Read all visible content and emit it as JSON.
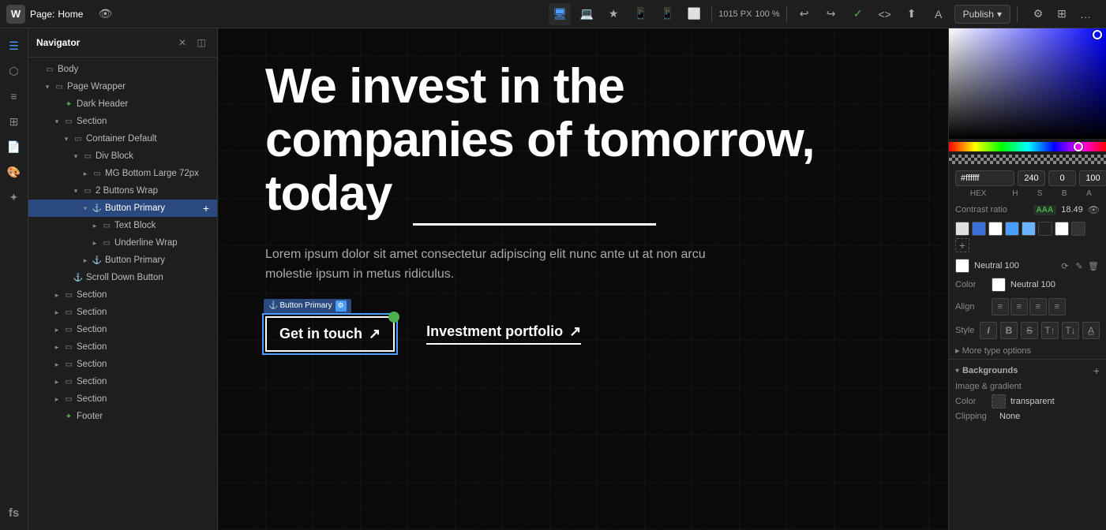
{
  "topbar": {
    "logo": "W",
    "page_label": "Page:",
    "page_name": "Home",
    "dimensions": "1015 PX",
    "zoom": "100 %",
    "publish_label": "Publish",
    "undo_label": "↩",
    "redo_label": "↪"
  },
  "navigator": {
    "title": "Navigator",
    "tree": [
      {
        "indent": 0,
        "type": "box",
        "label": "Body",
        "arrow": "",
        "icon_type": "box",
        "depth": 0
      },
      {
        "indent": 1,
        "type": "box",
        "label": "Page Wrapper",
        "arrow": "▾",
        "icon_type": "box",
        "depth": 1
      },
      {
        "indent": 2,
        "type": "green",
        "label": "Dark Header",
        "arrow": "",
        "icon_type": "green",
        "depth": 2
      },
      {
        "indent": 2,
        "type": "box",
        "label": "Section",
        "arrow": "▾",
        "icon_type": "box",
        "depth": 2,
        "has_add": true
      },
      {
        "indent": 3,
        "type": "box",
        "label": "Container Default",
        "arrow": "▾",
        "icon_type": "box",
        "depth": 3
      },
      {
        "indent": 4,
        "type": "box",
        "label": "Div Block",
        "arrow": "▾",
        "icon_type": "box",
        "depth": 4
      },
      {
        "indent": 5,
        "type": "box",
        "label": "MG Bottom Large 72px",
        "arrow": "▸",
        "icon_type": "box",
        "depth": 5
      },
      {
        "indent": 4,
        "type": "box",
        "label": "2 Buttons Wrap",
        "arrow": "▾",
        "icon_type": "box",
        "depth": 4,
        "has_add": true
      },
      {
        "indent": 5,
        "type": "link",
        "label": "Button Primary",
        "arrow": "▾",
        "icon_type": "link",
        "depth": 5,
        "selected": true,
        "has_add": true
      },
      {
        "indent": 6,
        "type": "box",
        "label": "Text Block",
        "arrow": "▸",
        "icon_type": "box",
        "depth": 6
      },
      {
        "indent": 6,
        "type": "box",
        "label": "Underline Wrap",
        "arrow": "▸",
        "icon_type": "box",
        "depth": 6
      },
      {
        "indent": 5,
        "type": "link",
        "label": "Button Primary",
        "arrow": "▸",
        "icon_type": "link",
        "depth": 5,
        "has_add": true
      },
      {
        "indent": 3,
        "type": "link",
        "label": "Scroll Down Button",
        "arrow": "",
        "icon_type": "link",
        "depth": 3,
        "has_add": true
      },
      {
        "indent": 2,
        "type": "box",
        "label": "Section",
        "arrow": "▸",
        "icon_type": "box",
        "depth": 2
      },
      {
        "indent": 2,
        "type": "box",
        "label": "Section",
        "arrow": "▸",
        "icon_type": "box",
        "depth": 2
      },
      {
        "indent": 2,
        "type": "box",
        "label": "Section",
        "arrow": "▸",
        "icon_type": "box",
        "depth": 2
      },
      {
        "indent": 2,
        "type": "box",
        "label": "Section",
        "arrow": "▸",
        "icon_type": "box",
        "depth": 2
      },
      {
        "indent": 2,
        "type": "box",
        "label": "Section",
        "arrow": "▸",
        "icon_type": "box",
        "depth": 2
      },
      {
        "indent": 2,
        "type": "box",
        "label": "Section",
        "arrow": "▸",
        "icon_type": "box",
        "depth": 2
      },
      {
        "indent": 2,
        "type": "box",
        "label": "Section",
        "arrow": "▸",
        "icon_type": "box",
        "depth": 2
      },
      {
        "indent": 2,
        "type": "green",
        "label": "Footer",
        "arrow": "",
        "icon_type": "green",
        "depth": 2
      }
    ]
  },
  "canvas": {
    "hero_line1": "We invest in the",
    "hero_line2": "companies of tomorrow,",
    "hero_line3": "today",
    "hero_underline": "___________",
    "subtitle": "Lorem ipsum dolor sit amet consectetur adipiscing elit nunc ante ut at non arcu molestie ipsum in metus ridiculus.",
    "btn1_label": "Get in touch",
    "btn1_icon": "↗",
    "btn2_label": "Investment portfolio",
    "btn2_icon": "↗",
    "selected_element_label": "Button Primary"
  },
  "color_panel": {
    "hex_value": "#ffffff",
    "h_value": "240",
    "s_value": "0",
    "b_value": "100",
    "a_value": "100",
    "hex_label": "HEX",
    "h_label": "H",
    "s_label": "S",
    "b_label": "B",
    "a_label": "A",
    "contrast_label": "Contrast ratio",
    "contrast_aaa": "AAA",
    "contrast_value": "18.49",
    "swatches": [
      {
        "color": "#e0e0e0"
      },
      {
        "color": "#3a6fd8"
      },
      {
        "color": "#ffffff"
      },
      {
        "color": "#4a9eff"
      },
      {
        "color": "#6ab4ff"
      },
      {
        "color": "#1a1a1a"
      },
      {
        "color": "#ffffff"
      },
      {
        "color": "#333333"
      }
    ],
    "saved_color_label": "Neutral 100",
    "color_section_label": "Color",
    "color_value_label": "Neutral 100",
    "align_section_label": "Align",
    "style_section_label": "Style",
    "style_italic": "I",
    "style_decoration": "Decoration",
    "more_options": "▸ More type options",
    "backgrounds_title": "Backgrounds",
    "image_gradient_label": "Image & gradient",
    "color_bg_label": "Color",
    "color_bg_value": "transparent",
    "clipping_label": "Clipping",
    "clipping_value": "None"
  }
}
